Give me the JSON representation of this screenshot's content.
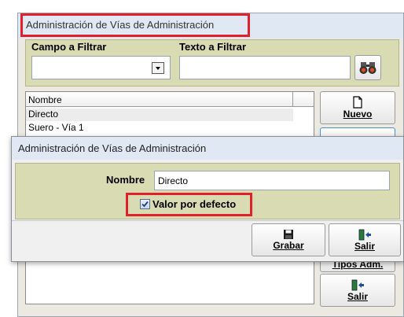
{
  "back_window": {
    "title": "Administración de Vías de Administración",
    "campo_label": "Campo a Filtrar",
    "texto_label": "Texto a Filtrar",
    "campo_value": "",
    "texto_value": "",
    "list_header": "Nombre",
    "rows": [
      "Directo",
      "Suero - Vía 1"
    ],
    "nuevo_label": "Nuevo",
    "tipos_label": "Tipos Adm.",
    "salir_label": "Salir"
  },
  "dialog": {
    "title": "Administración de Vías de Administración",
    "nombre_label": "Nombre",
    "nombre_value": "Directo",
    "checkbox_label": "Valor por defecto",
    "checkbox_checked": true,
    "grabar_label": "Grabar",
    "salir_label": "Salir"
  },
  "colors": {
    "panel_bg": "#d9dcb3",
    "title_bg": "#dfe8f3",
    "highlight": "#e0202a",
    "window_bg": "#eceae0"
  }
}
